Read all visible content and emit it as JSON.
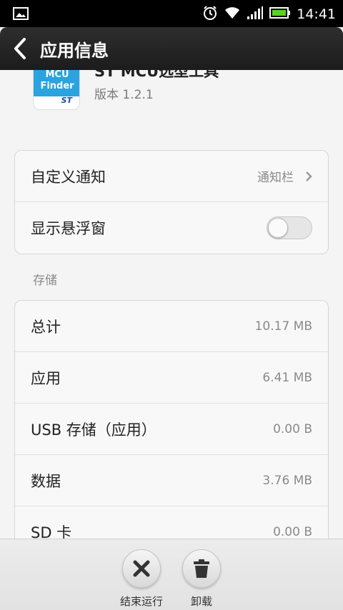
{
  "status_bar": {
    "time": "14:41"
  },
  "header": {
    "title": "应用信息"
  },
  "app": {
    "icon_text_line1": "MCU",
    "icon_text_line2": "Finder",
    "icon_brand": "ST",
    "name": "ST MCU选型工具",
    "version": "版本 1.2.1"
  },
  "settings": {
    "custom_notification": {
      "label": "自定义通知",
      "value": "通知栏"
    },
    "floating_window": {
      "label": "显示悬浮窗",
      "enabled": false
    }
  },
  "storage": {
    "section_title": "存储",
    "rows": [
      {
        "label": "总计",
        "value": "10.17 MB"
      },
      {
        "label": "应用",
        "value": "6.41 MB"
      },
      {
        "label": "USB 存储（应用）",
        "value": "0.00 B"
      },
      {
        "label": "数据",
        "value": "3.76 MB"
      },
      {
        "label": "SD 卡",
        "value": "0.00 B"
      }
    ]
  },
  "actions": {
    "force_stop": {
      "label": "结束运行",
      "icon": "close-icon"
    },
    "uninstall": {
      "label": "卸载",
      "icon": "trash-icon"
    }
  }
}
